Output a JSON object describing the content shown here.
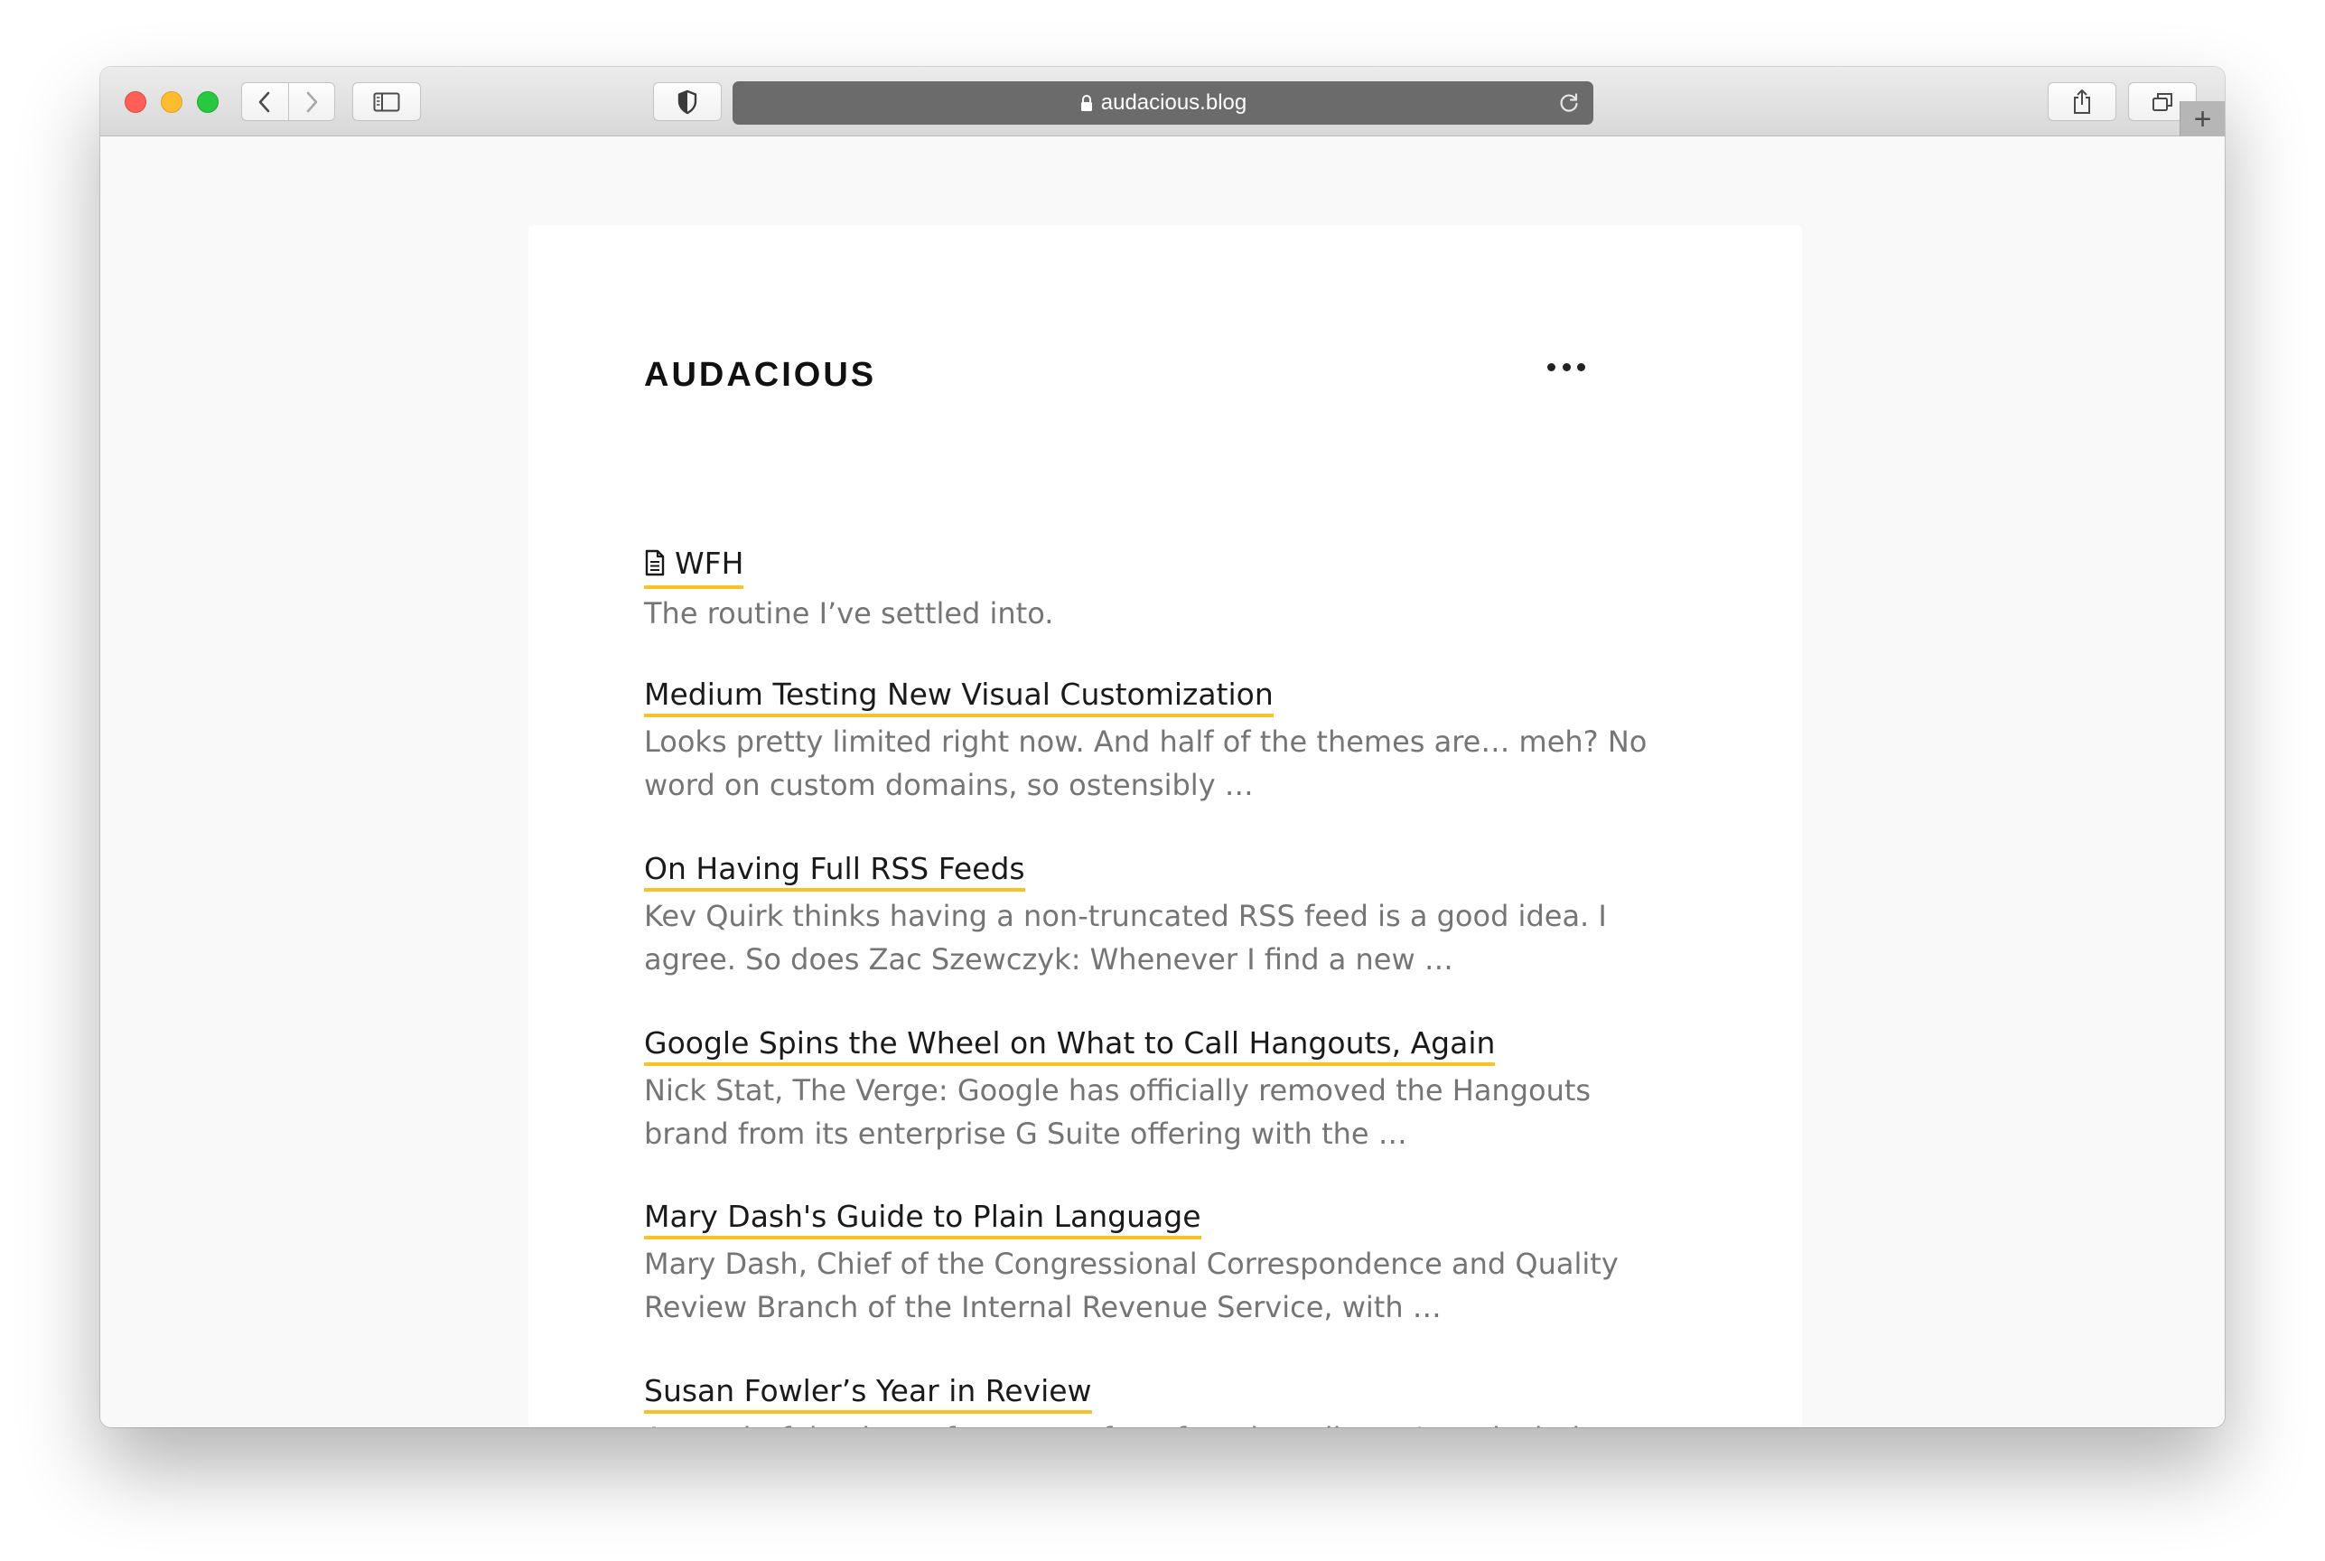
{
  "browser": {
    "address": "audacious.blog",
    "icons": {
      "back": "chevron-left-icon",
      "forward": "chevron-right-icon",
      "sidebar": "sidebar-icon",
      "privacy": "shield-icon",
      "lock": "lock-icon",
      "reload": "reload-icon",
      "share": "share-icon",
      "tabs": "tabs-icon",
      "new_tab": "+"
    }
  },
  "site": {
    "title": "AUDACIOUS",
    "menu_icon": "more-horizontal-icon",
    "accent_color": "#f6c12a"
  },
  "posts": [
    {
      "title": "WFH",
      "icon": "document-icon",
      "excerpt": "The routine I’ve settled into."
    },
    {
      "title": "Medium Testing New Visual Customization",
      "excerpt": "Looks pretty limited right now. And half of the themes are… meh? No word on custom domains, so ostensibly …"
    },
    {
      "title": "On Having Full RSS Feeds",
      "excerpt": "Kev Quirk thinks having a non-truncated RSS feed is a good idea. I agree. So does Zac Szewczyk: Whenever I find a new …"
    },
    {
      "title": "Google Spins the Wheel on What to Call Hangouts, Again",
      "excerpt": "Nick Stat, The Verge: Google has officially removed the Hangouts brand from its enterprise G Suite offering with the …"
    },
    {
      "title": "Mary Dash's Guide to Plain Language",
      "excerpt": "Mary Dash, Chief of the Congressional Correspondence and Quality Review Branch of the Internal Revenue Service, with …"
    },
    {
      "title": "Susan Fowler’s Year in Review",
      "excerpt": "A wonderful writeup from one of my favorite editors. I particularly"
    }
  ]
}
